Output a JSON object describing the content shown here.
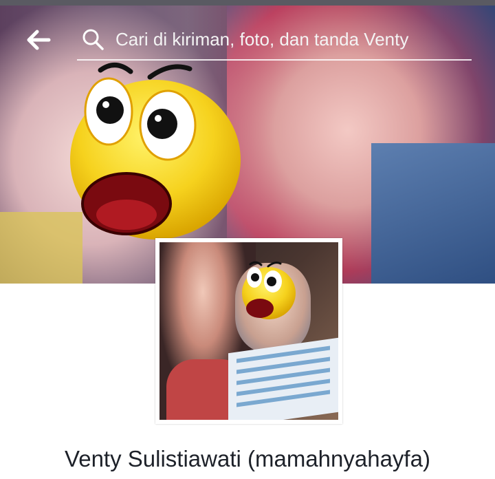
{
  "header": {
    "back_icon": "back-arrow-icon",
    "search_icon": "search-icon",
    "search_placeholder": "Cari di kiriman, foto, dan tanda Venty"
  },
  "cover": {
    "overlay": "surprised-emoji"
  },
  "profile": {
    "overlay": "surprised-emoji",
    "name": "Venty Sulistiawati (mamahnyahayfa)"
  },
  "colors": {
    "name_text": "#1d2129",
    "search_text": "#f4f4f4",
    "emoji_yellow": "#f6d21e"
  }
}
